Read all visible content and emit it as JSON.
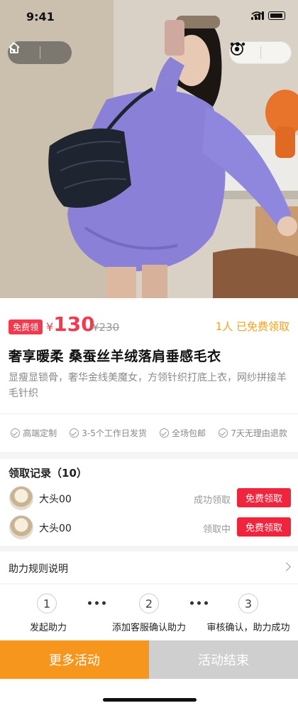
{
  "status_bar": {
    "time": "9:41"
  },
  "navigation": {
    "back_icon": "chevron-left-icon",
    "home_icon": "home-icon",
    "more_icon": "more-dots-icon",
    "close_icon": "target-circle-icon"
  },
  "product": {
    "badge": "免费领",
    "currency": "¥",
    "price": "130",
    "original_price": "¥230",
    "claimed_text": "1人 已免费领取",
    "title": "奢享暖柔 桑蚕丝羊绒落肩垂感毛衣",
    "subtitle": "显瘦显锁骨，奢华金线美魔女，方领针织打底上衣，网纱拼接羊毛针织"
  },
  "features": [
    "高端定制",
    "3-5个工作日发货",
    "全场包邮",
    "7天无理由退款"
  ],
  "records": {
    "title": "领取记录（10）",
    "rows": [
      {
        "name": "大头00",
        "status": "成功领取",
        "button": "免费领取"
      },
      {
        "name": "大头00",
        "status": "领取中",
        "button": "免费领取"
      }
    ]
  },
  "rules": {
    "title": "助力规则说明"
  },
  "steps": [
    {
      "num": "1",
      "label": "发起助力"
    },
    {
      "num": "2",
      "label": "添加客服确认助力"
    },
    {
      "num": "3",
      "label": "审核确认，助力成功"
    }
  ],
  "footer": {
    "more": "更多活动",
    "ended": "活动结束"
  },
  "colors": {
    "accent_red": "#f23a4f",
    "orange": "#f6961c",
    "claimed_orange": "#f0a020",
    "disabled_gray": "#cfcfcf"
  }
}
